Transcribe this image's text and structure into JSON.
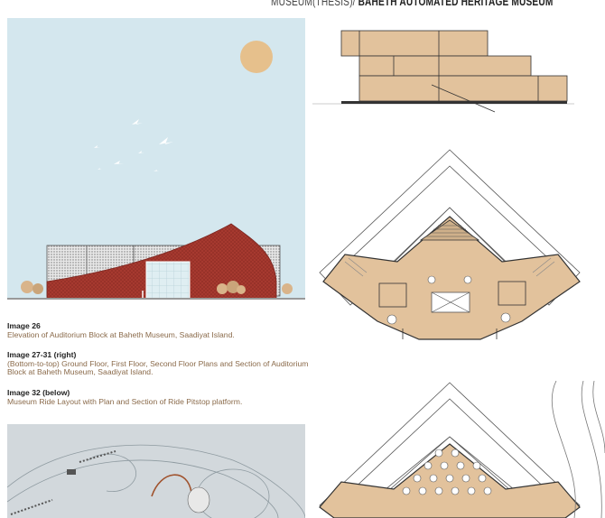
{
  "header": {
    "prefix": "MUSEUM(THESIS)/",
    "title": "BAHETH AUTOMATED HERITAGE MUSEUM"
  },
  "captions": [
    {
      "title": "Image 26",
      "text": "Elevation of Auditorium Block at Baheth Museum, Saadiyat Island."
    },
    {
      "title": "Image 27-31 (right)",
      "text": "(Bottom-to-top) Ground Floor, First Floor, Second Floor Plans and Section of Auditorium Block at Baheth Museum, Saadiyat Island."
    },
    {
      "title": "Image 32 (below)",
      "text": "Museum Ride Layout with Plan and Section of Ride Pitstop platform."
    }
  ],
  "colors": {
    "sky": "#d4e7ee",
    "sun": "#e6c08c",
    "brick": "#a83a30",
    "wood": "#e2c29c",
    "text_accent": "#8a6a4a",
    "ride_bg": "#d2d8dc"
  },
  "icons": [
    "sun-icon",
    "bird-icon",
    "tree-icon"
  ]
}
